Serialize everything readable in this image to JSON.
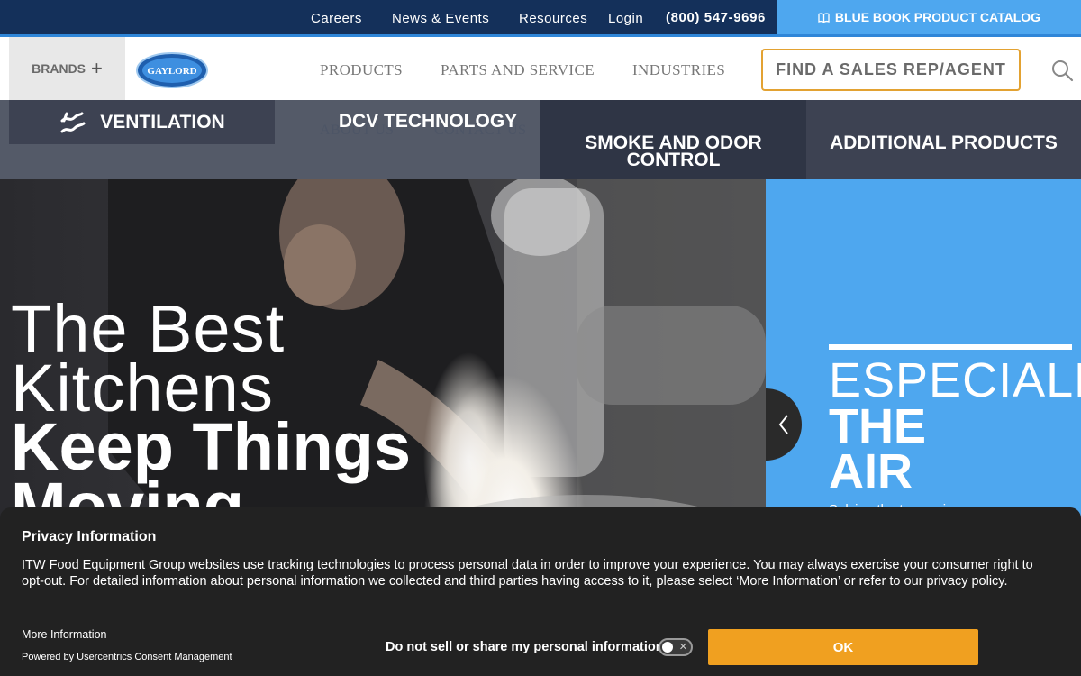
{
  "topbar": {
    "links": [
      "Careers",
      "News & Events",
      "Resources",
      "Login"
    ],
    "phone": "(800) 547-9696",
    "catalog_label": "BLUE BOOK PRODUCT CATALOG"
  },
  "nav": {
    "brands_label": "BRANDS",
    "logo_text": "GAYLORD",
    "items": [
      "PRODUCTS",
      "PARTS AND SERVICE",
      "INDUSTRIES"
    ],
    "faded_items": [
      "ABOUT US",
      "CONTACT US"
    ],
    "sales_rep_label": "FIND A SALES REP/AGENT"
  },
  "subnav": {
    "ventilation": "VENTILATION",
    "dcv": "DCV TECHNOLOGY",
    "smoke_line1": "SMOKE AND ODOR",
    "smoke_line2": "CONTROL",
    "additional": "ADDITIONAL PRODUCTS"
  },
  "hero": {
    "line1": "The Best",
    "line2": "Kitchens",
    "line3": "Keep Things",
    "line4": "Moving",
    "side_line1": "ESPECIALLY",
    "side_line2": "THE",
    "side_line3": "AIR",
    "side_sub": "Solving the two main"
  },
  "consent": {
    "title": "Privacy Information",
    "text": "ITW Food Equipment Group websites use tracking technologies to process personal data in order to improve your experience. You may always exercise your consumer right to opt-out. For detailed information about personal information we collected and third parties having access to it, please select ‘More Information’ or refer to our privacy policy.",
    "more_info": "More Information",
    "powered": "Powered by Usercentrics Consent Management",
    "do_not_sell": "Do not sell or share my personal information",
    "ok_label": "OK"
  },
  "colors": {
    "topbar": "#14305a",
    "accent_blue": "#4ea7ef",
    "accent_orange": "#f0a020"
  }
}
